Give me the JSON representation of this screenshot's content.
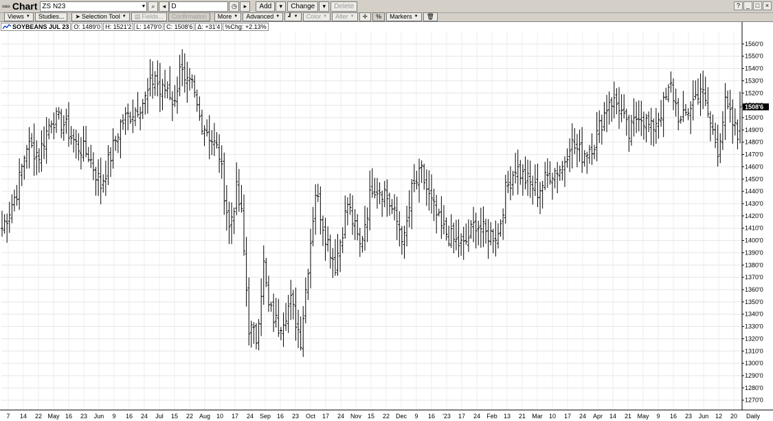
{
  "window": {
    "title": "Chart",
    "symbol": "ZS N23",
    "interval": "D",
    "buttons": {
      "add": "Add",
      "change": "Change",
      "delete": "Delete"
    }
  },
  "toolbar": {
    "views": "Views",
    "studies": "Studies...",
    "selection_tool": "Selection Tool",
    "fields": "Fields...",
    "confirmation": "Confirmation",
    "more": "More",
    "advanced": "Advanced",
    "color": "Color",
    "alter": "Alter",
    "percent": "%",
    "markers": "Markers"
  },
  "header": {
    "symbol": "SOYBEANS JUL 23",
    "open": "O: 1489'0",
    "high": "H: 1521'2",
    "low": "L: 1479'0",
    "close": "C: 1508'6",
    "delta": "Δ: +31'4",
    "pct_change": "%Chg: +2.13%"
  },
  "chart_data": {
    "type": "ohlc-bar",
    "title": "SOYBEANS JUL 23",
    "y_axis": {
      "min": 1262,
      "max": 1570,
      "ticks": [
        1270,
        1280,
        1290,
        1300,
        1310,
        1320,
        1330,
        1340,
        1350,
        1360,
        1370,
        1380,
        1390,
        1400,
        1410,
        1420,
        1430,
        1440,
        1450,
        1460,
        1470,
        1480,
        1490,
        1500,
        1510,
        1520,
        1530,
        1540,
        1550,
        1560
      ],
      "tick_labels": [
        "1270'0",
        "1280'0",
        "1290'0",
        "1300'0",
        "1310'0",
        "1320'0",
        "1330'0",
        "1340'0",
        "1350'0",
        "1360'0",
        "1370'0",
        "1380'0",
        "1390'0",
        "1400'0",
        "1410'0",
        "1420'0",
        "1430'0",
        "1440'0",
        "1450'0",
        "1460'0",
        "1470'0",
        "1480'0",
        "1490'0",
        "1500'0",
        "1510'0",
        "1520'0",
        "1530'0",
        "1540'0",
        "1550'0",
        "1560'0"
      ],
      "last_price_label": "1508'6",
      "last_price": 1508.75
    },
    "x_axis": {
      "labels": [
        "7",
        "14",
        "22",
        "May",
        "16",
        "23",
        "Jun",
        "9",
        "16",
        "24",
        "Jul",
        "15",
        "22",
        "Aug",
        "10",
        "17",
        "24",
        "Sep",
        "16",
        "23",
        "Oct",
        "17",
        "24",
        "Nov",
        "15",
        "22",
        "Dec",
        "9",
        "16",
        "'23",
        "17",
        "24",
        "Feb",
        "13",
        "21",
        "Mar",
        "10",
        "17",
        "24",
        "Apr",
        "14",
        "21",
        "May",
        "9",
        "16",
        "23",
        "Jun",
        "12",
        "20"
      ],
      "period_label": "Daily"
    },
    "grid": true,
    "bars_count": 300,
    "anchors": [
      [
        0,
        1410
      ],
      [
        6,
        1440
      ],
      [
        10,
        1478
      ],
      [
        15,
        1470
      ],
      [
        20,
        1500
      ],
      [
        25,
        1495
      ],
      [
        30,
        1478
      ],
      [
        35,
        1470
      ],
      [
        40,
        1445
      ],
      [
        45,
        1475
      ],
      [
        48,
        1495
      ],
      [
        53,
        1505
      ],
      [
        58,
        1515
      ],
      [
        62,
        1535
      ],
      [
        64,
        1520
      ],
      [
        67,
        1525
      ],
      [
        70,
        1510
      ],
      [
        72,
        1545
      ],
      [
        74,
        1525
      ],
      [
        77,
        1525
      ],
      [
        80,
        1500
      ],
      [
        83,
        1490
      ],
      [
        88,
        1470
      ],
      [
        92,
        1410
      ],
      [
        95,
        1440
      ],
      [
        97,
        1420
      ],
      [
        100,
        1330
      ],
      [
        103,
        1320
      ],
      [
        106,
        1380
      ],
      [
        108,
        1345
      ],
      [
        112,
        1330
      ],
      [
        117,
        1350
      ],
      [
        121,
        1320
      ],
      [
        124,
        1380
      ],
      [
        127,
        1440
      ],
      [
        131,
        1405
      ],
      [
        135,
        1380
      ],
      [
        140,
        1430
      ],
      [
        145,
        1395
      ],
      [
        150,
        1445
      ],
      [
        155,
        1440
      ],
      [
        160,
        1415
      ],
      [
        163,
        1400
      ],
      [
        166,
        1440
      ],
      [
        170,
        1455
      ],
      [
        173,
        1435
      ],
      [
        178,
        1410
      ],
      [
        183,
        1400
      ],
      [
        187,
        1395
      ],
      [
        192,
        1415
      ],
      [
        196,
        1405
      ],
      [
        201,
        1405
      ],
      [
        204,
        1440
      ],
      [
        208,
        1460
      ],
      [
        212,
        1450
      ],
      [
        217,
        1440
      ],
      [
        222,
        1455
      ],
      [
        227,
        1460
      ],
      [
        230,
        1480
      ],
      [
        235,
        1470
      ],
      [
        240,
        1480
      ],
      [
        246,
        1515
      ],
      [
        250,
        1510
      ],
      [
        254,
        1485
      ],
      [
        258,
        1505
      ],
      [
        263,
        1490
      ],
      [
        267,
        1505
      ],
      [
        271,
        1525
      ],
      [
        275,
        1495
      ],
      [
        279,
        1510
      ],
      [
        283,
        1525
      ],
      [
        287,
        1495
      ],
      [
        290,
        1475
      ],
      [
        293,
        1510
      ],
      [
        297,
        1490
      ],
      [
        300,
        1470
      ]
    ]
  }
}
